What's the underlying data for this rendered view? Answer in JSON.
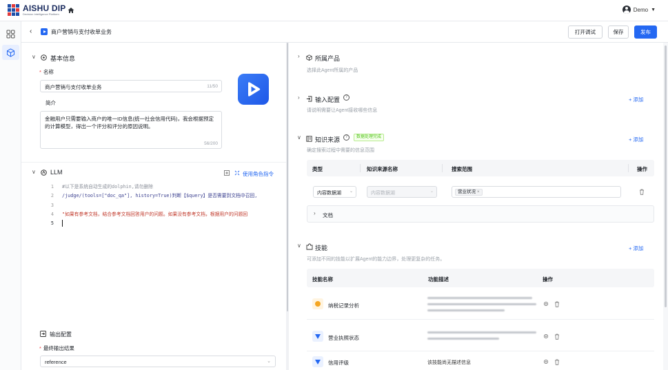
{
  "brand": {
    "name": "AISHU DIP",
    "tagline": "Decision Intelligence Platform"
  },
  "user": {
    "name": "Demo"
  },
  "page": {
    "title": "商户营销与支付收单业务"
  },
  "actions": {
    "debug": "打开调试",
    "save": "保存",
    "publish": "发布"
  },
  "basic": {
    "title": "基本信息",
    "name_label": "名称",
    "name_value": "商户营销与支付收单业务",
    "name_count": "11/50",
    "desc_label": "简介",
    "desc_value": "金融用户只需要输入商户的唯一ID信息(统一社会信用代码)，我会根据预定的计算模型，得出一个评分和评分的原因说明。",
    "desc_count": "56/200"
  },
  "llm": {
    "title": "LLM",
    "role_cmd": "使用角色指令",
    "code": [
      {
        "n": "1",
        "text": "#以下是系统自动生成的dolphin,请勿删除"
      },
      {
        "n": "2",
        "text": "/judge/(tools=[\"doc_qa\"], history=True)判断【$query】是否需要到文档中召回,"
      },
      {
        "n": "3",
        "text": ""
      },
      {
        "n": "4",
        "text": "\"如果有参考文档，结合参考文档回答用户的问题。如果没有参考文档，根据用户的问题回"
      },
      {
        "n": "5",
        "text": ""
      }
    ]
  },
  "output": {
    "title": "输出配置",
    "final_label": "最终输出结果",
    "final_value": "reference"
  },
  "product": {
    "title": "所属产品",
    "desc": "选择此Agent所属的产品"
  },
  "input_cfg": {
    "title": "输入配置",
    "desc": "请说明需要让Agent接收哪些信息",
    "add": "+ 添加"
  },
  "knowledge": {
    "title": "知识来源",
    "badge": "数据处理完成",
    "desc": "确定搜索过程中需要的信息范围",
    "add": "+ 添加",
    "cols": [
      "类型",
      "知识来源名称",
      "搜索范围",
      "操作"
    ],
    "type_value": "内容数据湖",
    "source_placeholder": "内容数据湖",
    "scope_tag": "营业状况",
    "doc_label": "文档"
  },
  "skills": {
    "title": "技能",
    "desc": "可添加不同的技能以扩展Agent的能力边界，处理更复杂的任务。",
    "add": "+ 添加",
    "cols": [
      "技能名称",
      "功能描述",
      "操作"
    ],
    "rows": [
      {
        "name": "纳税记录分析",
        "desc": ""
      },
      {
        "name": "营业执照状态",
        "desc": ""
      },
      {
        "name": "信用评级",
        "desc": "该技能尚无描述信息"
      }
    ]
  },
  "colors": {
    "primary": "#2468f2",
    "success": "#52c41a",
    "border": "#d9dce1"
  }
}
